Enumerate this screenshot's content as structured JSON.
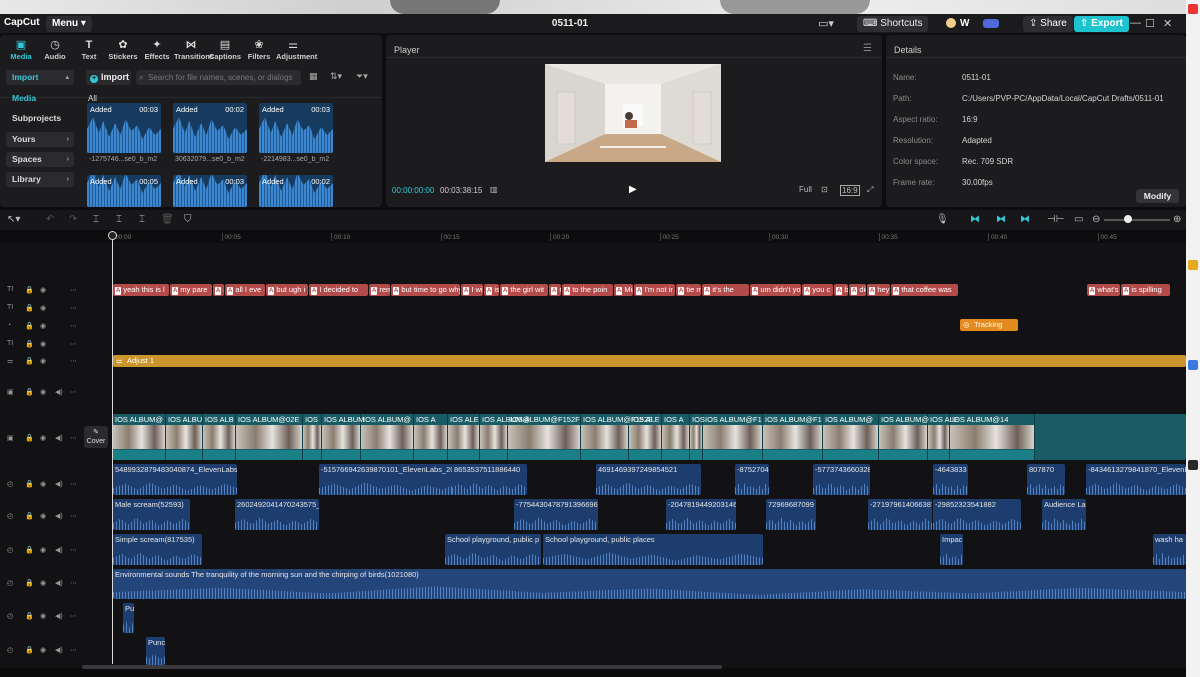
{
  "app": {
    "logo": "CapCut",
    "menu_label": "Menu",
    "project_title": "0511-01",
    "shortcuts_label": "Shortcuts",
    "user_initial": "W",
    "share_label": "Share",
    "export_label": "Export"
  },
  "toolbar_tabs": [
    {
      "label": "Media",
      "icon": "media-icon",
      "glyph": "▣"
    },
    {
      "label": "Audio",
      "icon": "audio-icon",
      "glyph": "◷"
    },
    {
      "label": "Text",
      "icon": "text-icon",
      "glyph": "T"
    },
    {
      "label": "Stickers",
      "icon": "stickers-icon",
      "glyph": "✿"
    },
    {
      "label": "Effects",
      "icon": "effects-icon",
      "glyph": "✦"
    },
    {
      "label": "Transitions",
      "icon": "transitions-icon",
      "glyph": "⋈"
    },
    {
      "label": "Captions",
      "icon": "captions-icon",
      "glyph": "▤"
    },
    {
      "label": "Filters",
      "icon": "filters-icon",
      "glyph": "❀"
    },
    {
      "label": "Adjustment",
      "icon": "adjustment-icon",
      "glyph": "⚌"
    }
  ],
  "media_sidebar": {
    "import": "Import",
    "media": "Media",
    "subprojects": "Subprojects",
    "yours": "Yours",
    "spaces": "Spaces",
    "library": "Library"
  },
  "media": {
    "import_button": "Import",
    "search_placeholder": "Search for file names, scenes, or dialogs",
    "all_label": "All",
    "items": [
      {
        "status": "Added",
        "duration": "00:03",
        "name": "-1275746...se0_b_m2"
      },
      {
        "status": "Added",
        "duration": "00:02",
        "name": "30632079...se0_b_m2"
      },
      {
        "status": "Added",
        "duration": "00:03",
        "name": "-2214983...se0_b_m2"
      },
      {
        "status": "Added",
        "duration": "00:05",
        "name": ""
      },
      {
        "status": "Added",
        "duration": "00:03",
        "name": ""
      },
      {
        "status": "Added",
        "duration": "00:02",
        "name": ""
      }
    ]
  },
  "player": {
    "label": "Player",
    "current_time": "00:00:00:00",
    "total_time": "00:03:38:15",
    "ratio_label": "16:9",
    "full_label": "Full"
  },
  "details": {
    "label": "Details",
    "rows": [
      {
        "key": "Name:",
        "value": "0511-01"
      },
      {
        "key": "Path:",
        "value": "C:/Users/PVP-PC/AppData/Local/CapCut Drafts/0511-01"
      },
      {
        "key": "Aspect ratio:",
        "value": "16:9"
      },
      {
        "key": "Resolution:",
        "value": "Adapted"
      },
      {
        "key": "Color space:",
        "value": "Rec. 709 SDR"
      },
      {
        "key": "Frame rate:",
        "value": "30.00fps"
      }
    ],
    "modify_label": "Modify"
  },
  "ruler_ticks": [
    "00:00",
    "00:05",
    "00:10",
    "00:15",
    "00:20",
    "00:25",
    "00:30",
    "00:35",
    "00:40",
    "00:45"
  ],
  "text_clips": [
    "yeah this is l",
    "my pare",
    "a",
    "all I eve",
    "but ugh i",
    "I decided to",
    "reme",
    "but time to go why",
    "I wis",
    "isn'",
    "the girl wit",
    "r",
    "to the poin",
    "Mia",
    "I'm not ir",
    "tie m",
    "it's the",
    "um didn't you",
    "you c",
    "but",
    "did y",
    "hey",
    "that coffee was",
    "what's",
    "is spilling"
  ],
  "tracking_label": "Tracking",
  "adjust_label": "Adjust 1",
  "cover_label": "Cover",
  "video_segments": [
    "IOS ALBUM@",
    "IOS ALBU",
    "IOS ALB",
    "IOS ALBUM@02E",
    "IOS",
    "IOS ALBUM",
    "IOS ALBUM@",
    "IOS A",
    "IOS ALE",
    "IOS ALBUM@",
    "IOS ALBUM@F152F",
    "IOS ALBUM@F152F",
    "IOS ALE",
    "IOS A",
    "IOS",
    "IOS ALBUM@F1",
    "IOS ALBUM@F1",
    "IOS ALBUM@",
    "IOS ALBUM@",
    "IOS ALE",
    "IOS ALBUM@14"
  ],
  "audio_rows": [
    {
      "clips": [
        "5489932879483040874_ElevenLabs_20",
        "-515766942639870101_ElevenLabs_20",
        "8653537511886440",
        "4691469397249854521",
        "-87527044",
        "-57737436603288",
        "-4643833",
        "807870",
        "-8434613279841870_ElevenLabs_20"
      ]
    },
    {
      "clips": [
        "Male scream(52593)",
        "2602492041470243575_E",
        "-7754430478791396696_E",
        "-2047819449203146",
        "72969687099",
        "-271979614066387",
        "-29852323541882",
        "Audience La"
      ]
    },
    {
      "clips": [
        "Simple scream(817535)",
        "School playground, public p",
        "School playground, public places",
        "Impac",
        "wash ha"
      ]
    },
    {
      "clips": [
        "Environmental sounds The tranquility of the morning sun and the chirping of birds(1021080)"
      ]
    },
    {
      "clips": [
        "Pu"
      ]
    },
    {
      "clips": [
        "Punc"
      ]
    }
  ]
}
